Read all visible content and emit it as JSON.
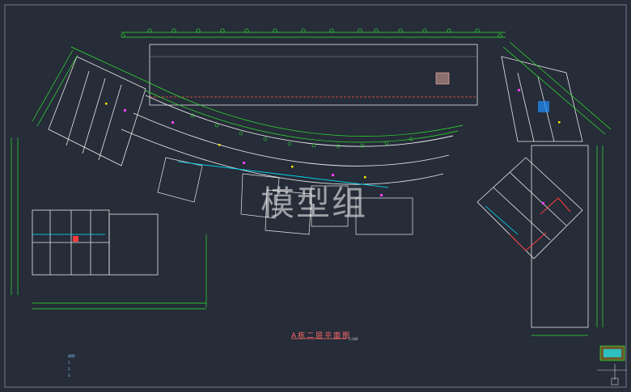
{
  "drawing": {
    "title": "A栋二层平面图",
    "scale": "1:100",
    "watermark": "模型组",
    "colors": {
      "background": "#262c38",
      "dimension": "#2ee62e",
      "wall": "#e8e8e8",
      "grid": "#d0d6ff",
      "accent_cyan": "#00e5ff",
      "accent_magenta": "#ff40ff",
      "accent_red": "#ff3b3b",
      "accent_yellow": "#ffe600"
    },
    "notes": {
      "line1": "说明：",
      "line2": "1.",
      "line3": "2.",
      "line4": "3."
    }
  }
}
